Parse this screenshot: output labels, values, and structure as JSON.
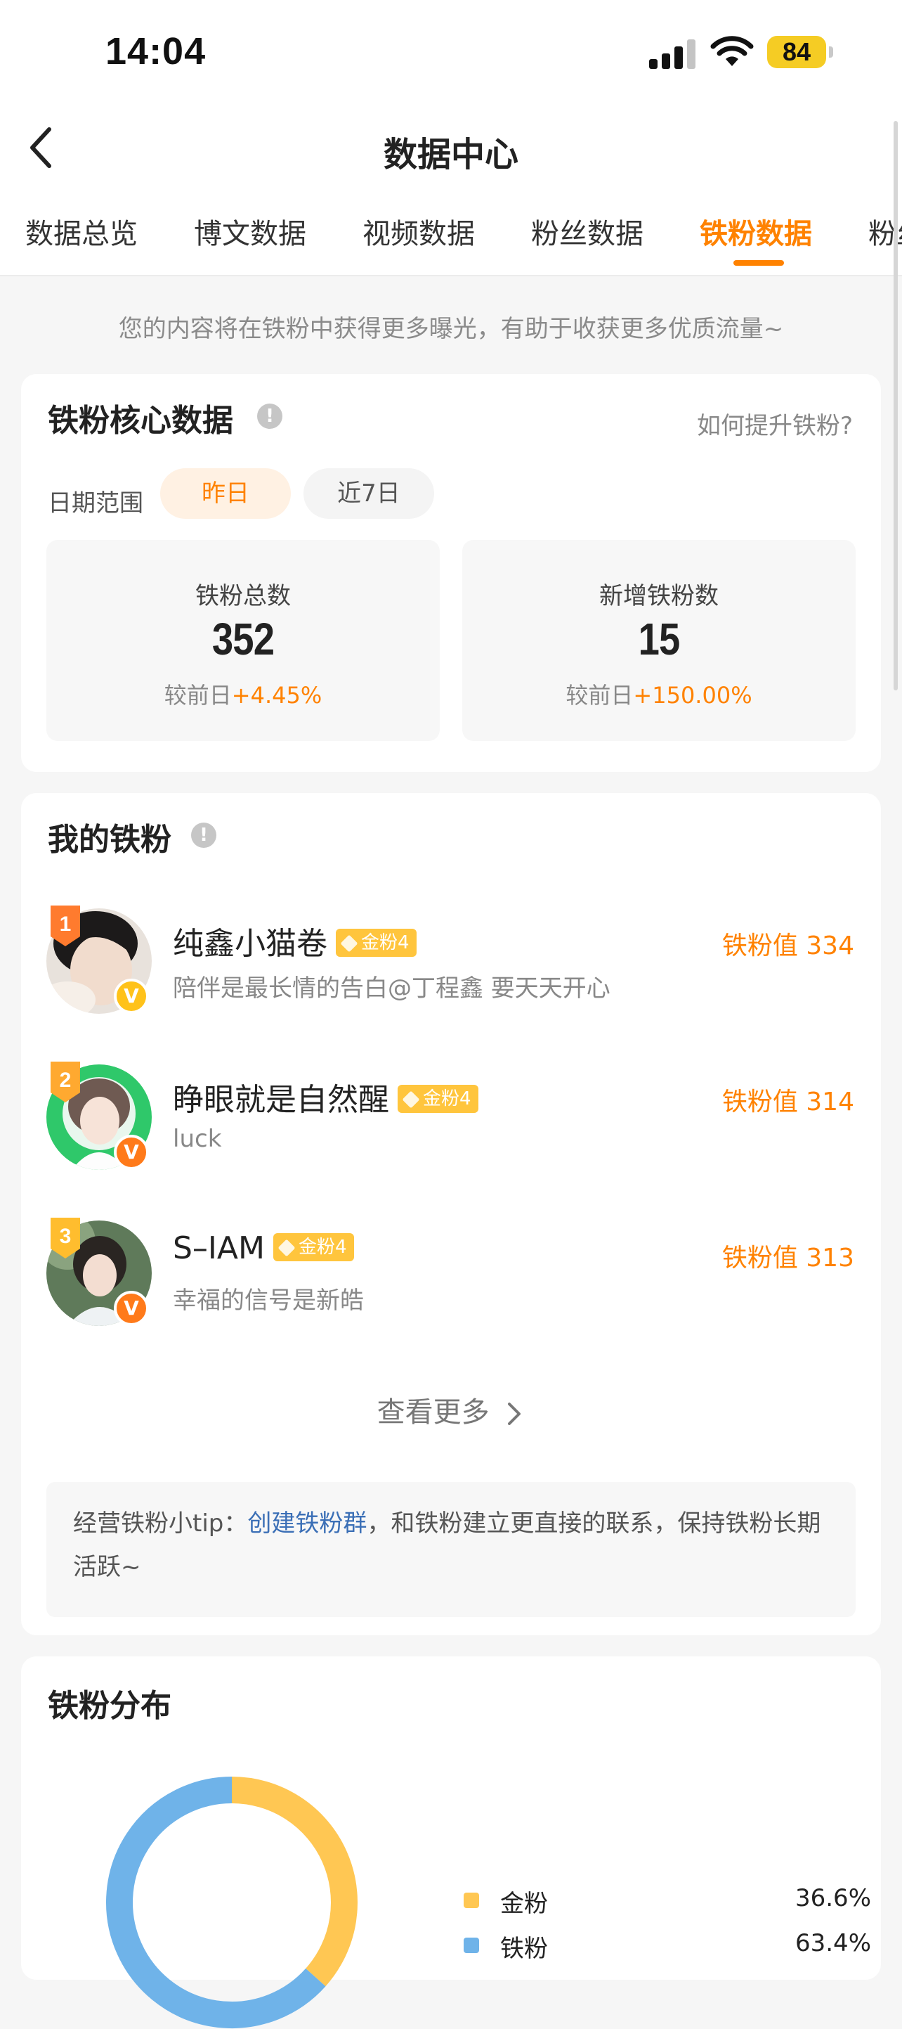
{
  "status_bar": {
    "time": "14:04",
    "battery": "84"
  },
  "header": {
    "title": "数据中心"
  },
  "tabs": [
    {
      "label": "数据总览"
    },
    {
      "label": "博文数据"
    },
    {
      "label": "视频数据"
    },
    {
      "label": "粉丝数据"
    },
    {
      "label": "铁粉数据",
      "active": true
    },
    {
      "label": "粉丝"
    }
  ],
  "hint": "您的内容将在铁粉中获得更多曝光，有助于收获更多优质流量~",
  "core": {
    "title": "铁粉核心数据",
    "how_link": "如何提升铁粉?",
    "range_label": "日期范围",
    "range_options": [
      "昨日",
      "近7日"
    ],
    "stats": [
      {
        "label": "铁粉总数",
        "value": "352",
        "compare_prefix": "较前日",
        "compare_value": "+4.45%"
      },
      {
        "label": "新增铁粉数",
        "value": "15",
        "compare_prefix": "较前日",
        "compare_value": "+150.00%"
      }
    ]
  },
  "my_fans": {
    "title": "我的铁粉",
    "list": [
      {
        "rank": "1",
        "name": "纯鑫小猫卷",
        "badge": "金粉4",
        "desc": "陪伴是最长情的告白@丁程鑫 要天天开心",
        "score_label": "铁粉值",
        "score": "334"
      },
      {
        "rank": "2",
        "name": "睁眼就是自然醒",
        "badge": "金粉4",
        "desc": "luck",
        "score_label": "铁粉值",
        "score": "314"
      },
      {
        "rank": "3",
        "name": "S–IAM",
        "badge": "金粉4",
        "desc": "幸福的信号是新皓",
        "score_label": "铁粉值",
        "score": "313"
      }
    ],
    "more": "查看更多",
    "tip_prefix": "经营铁粉小tip：",
    "tip_link": "创建铁粉群",
    "tip_suffix": "，和铁粉建立更直接的联系，保持铁粉长期活跃~"
  },
  "distribution": {
    "title": "铁粉分布",
    "chart_data": {
      "type": "pie",
      "categories": [
        "金粉",
        "铁粉"
      ],
      "values": [
        36.6,
        63.4
      ],
      "labels": [
        "36.6%",
        "63.4%"
      ],
      "colors": [
        "#ffc753",
        "#6fb3e9"
      ]
    }
  },
  "colors": {
    "accent": "#ff8200",
    "link": "#3b6fb6",
    "gold": "#ffc53d"
  }
}
